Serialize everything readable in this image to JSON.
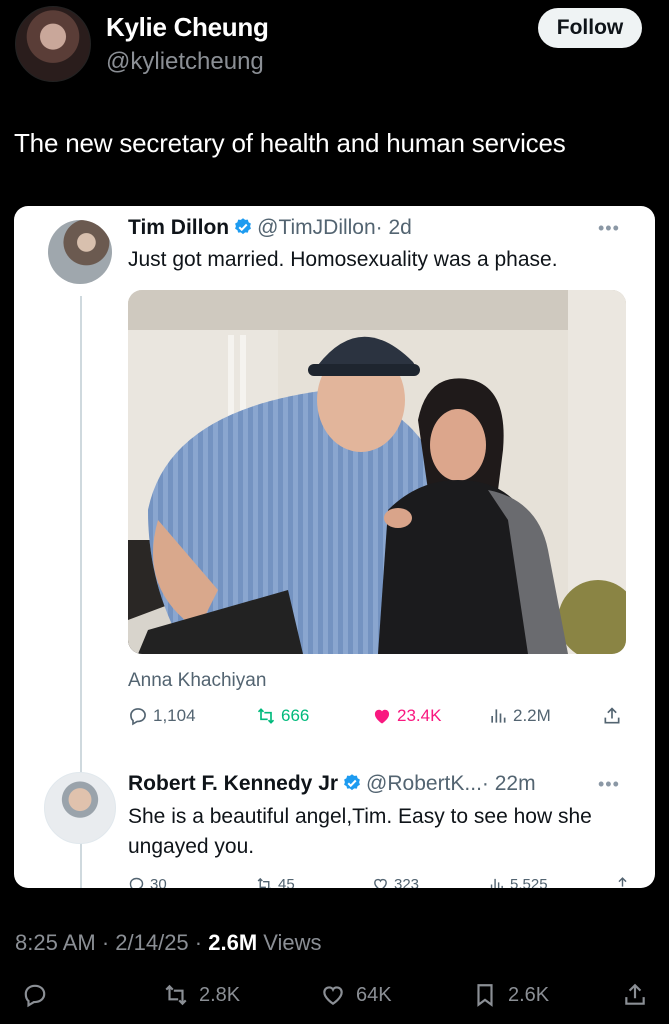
{
  "outer_tweet": {
    "name": "Kylie Cheung",
    "handle": "@kylietcheung",
    "follow_label": "Follow",
    "text": "The new secretary of health and human services"
  },
  "embedded": {
    "tim": {
      "name": "Tim Dillon",
      "handle": "@TimJDillon",
      "time": "· 2d",
      "text": "Just got married. Homosexuality was a phase.",
      "caption": "Anna Khachiyan",
      "stats": {
        "replies": "1,104",
        "retweets": "666",
        "likes": "23.4K",
        "views": "2.2M"
      }
    },
    "rfk": {
      "name": "Robert F. Kennedy Jr",
      "handle": "@RobertK...",
      "time": "· 22m",
      "text": "She is a beautiful angel,Tim. Easy to see how she ungayed you.",
      "stats": {
        "replies": "30",
        "retweets": "45",
        "likes": "323",
        "views": "5,525"
      }
    }
  },
  "meta": {
    "time_date": "8:25 AM · 2/14/25 · ",
    "views_count": "2.6M",
    "views_label": " Views"
  },
  "footer": {
    "retweets": "2.8K",
    "likes": "64K",
    "bookmarks": "2.6K"
  },
  "colors": {
    "like_pink": "#f91880",
    "retweet_green": "#00ba7c",
    "verified_blue": "#1d9bf0"
  }
}
